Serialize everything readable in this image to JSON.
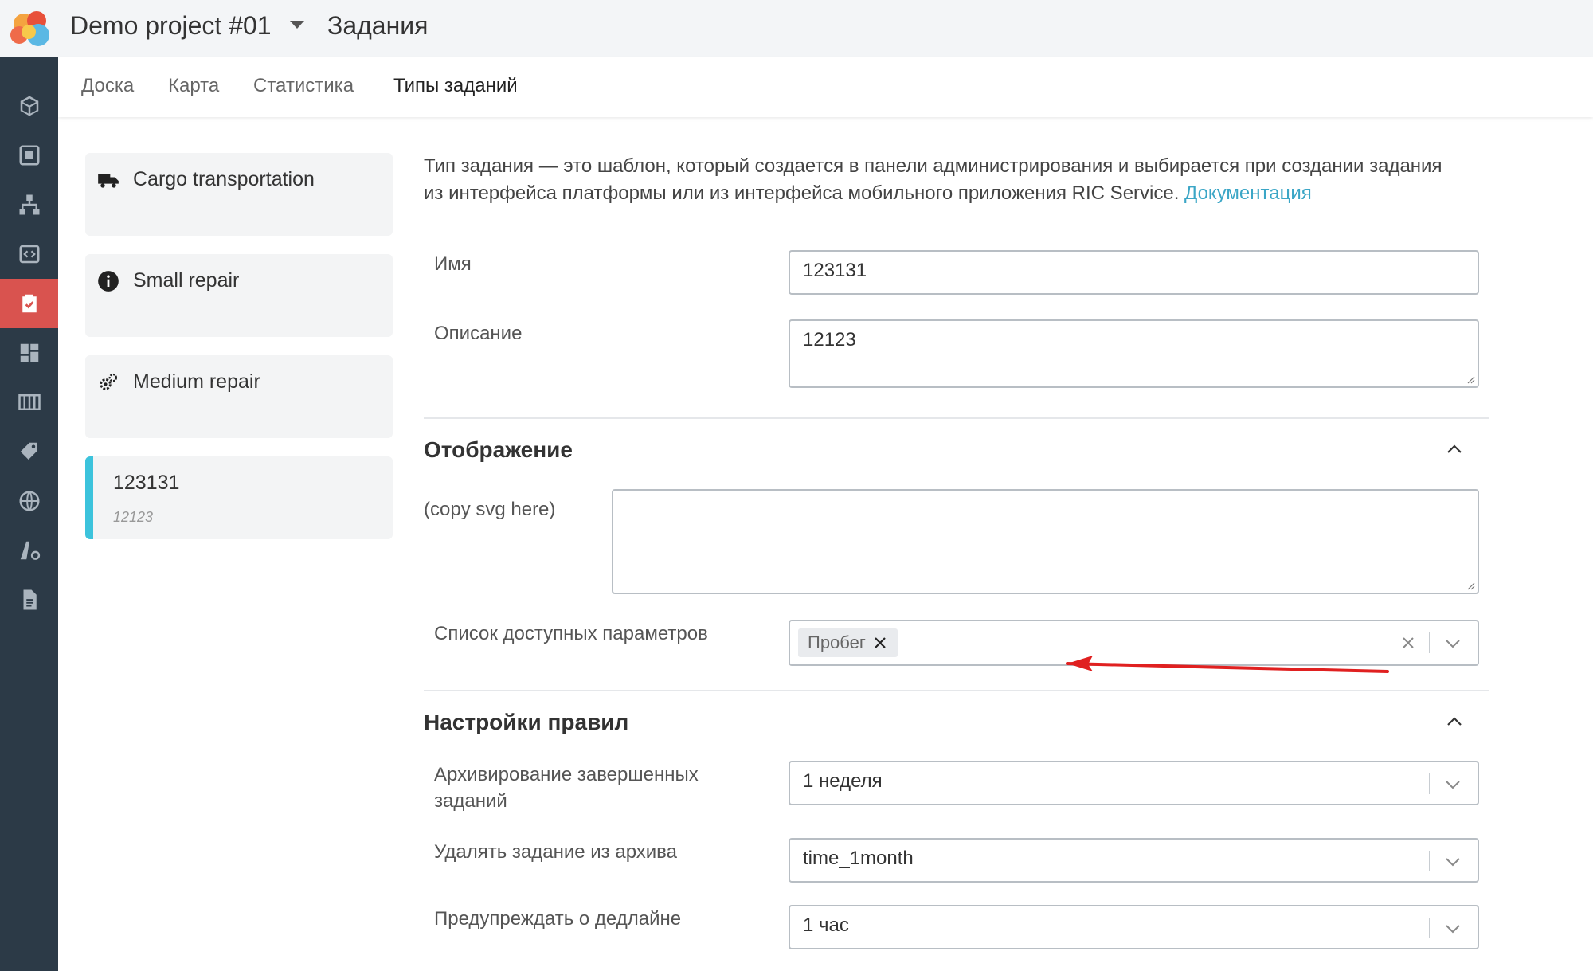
{
  "header": {
    "project": "Demo project #01",
    "section": "Задания"
  },
  "sidebar": {
    "items": [
      {
        "icon": "box-icon"
      },
      {
        "icon": "frame-icon"
      },
      {
        "icon": "hierarchy-icon"
      },
      {
        "icon": "code-window-icon"
      },
      {
        "icon": "clipboard-check-icon",
        "active": true
      },
      {
        "icon": "dashboard-icon"
      },
      {
        "icon": "columns-icon"
      },
      {
        "icon": "tag-icon"
      },
      {
        "icon": "globe-icon"
      },
      {
        "icon": "road-settings-icon"
      },
      {
        "icon": "document-icon"
      }
    ]
  },
  "tabs": [
    "Доска",
    "Карта",
    "Статистика",
    "Типы заданий"
  ],
  "task_types": [
    {
      "name": "Cargo transportation",
      "icon": "truck-icon"
    },
    {
      "name": "Small repair",
      "icon": "info-icon"
    },
    {
      "name": "Medium repair",
      "icon": "gears-icon"
    },
    {
      "name": "123131",
      "description": "12123",
      "selected": true
    }
  ],
  "intro": {
    "text": "Тип задания — это шаблон, который создается в панели администрирования и выбирается при создании задания из интерфейса платформы или из интерфейса мобильного приложения RIC Service.",
    "link": "Документация"
  },
  "form": {
    "name_label": "Имя",
    "name_value": "123131",
    "description_label": "Описание",
    "description_value": "12123"
  },
  "display_section": {
    "title": "Отображение",
    "svg_label": "(copy svg here)",
    "params_label": "Список доступных параметров",
    "params_chip": "Пробег"
  },
  "rules_section": {
    "title": "Настройки правил",
    "archive_label": "Архивирование завершенных заданий",
    "archive_value": "1 неделя",
    "delete_label": "Удалять задание из архива",
    "delete_value": "time_1month",
    "deadline_label": "Предупреждать о дедлайне",
    "deadline_value": "1 час"
  },
  "colors": {
    "sidebar": "#2c3a47",
    "active_nav": "#d9534f",
    "selected_accent": "#3cc3dc",
    "link": "#3ba6c6",
    "annotation_arrow": "#e02020"
  }
}
